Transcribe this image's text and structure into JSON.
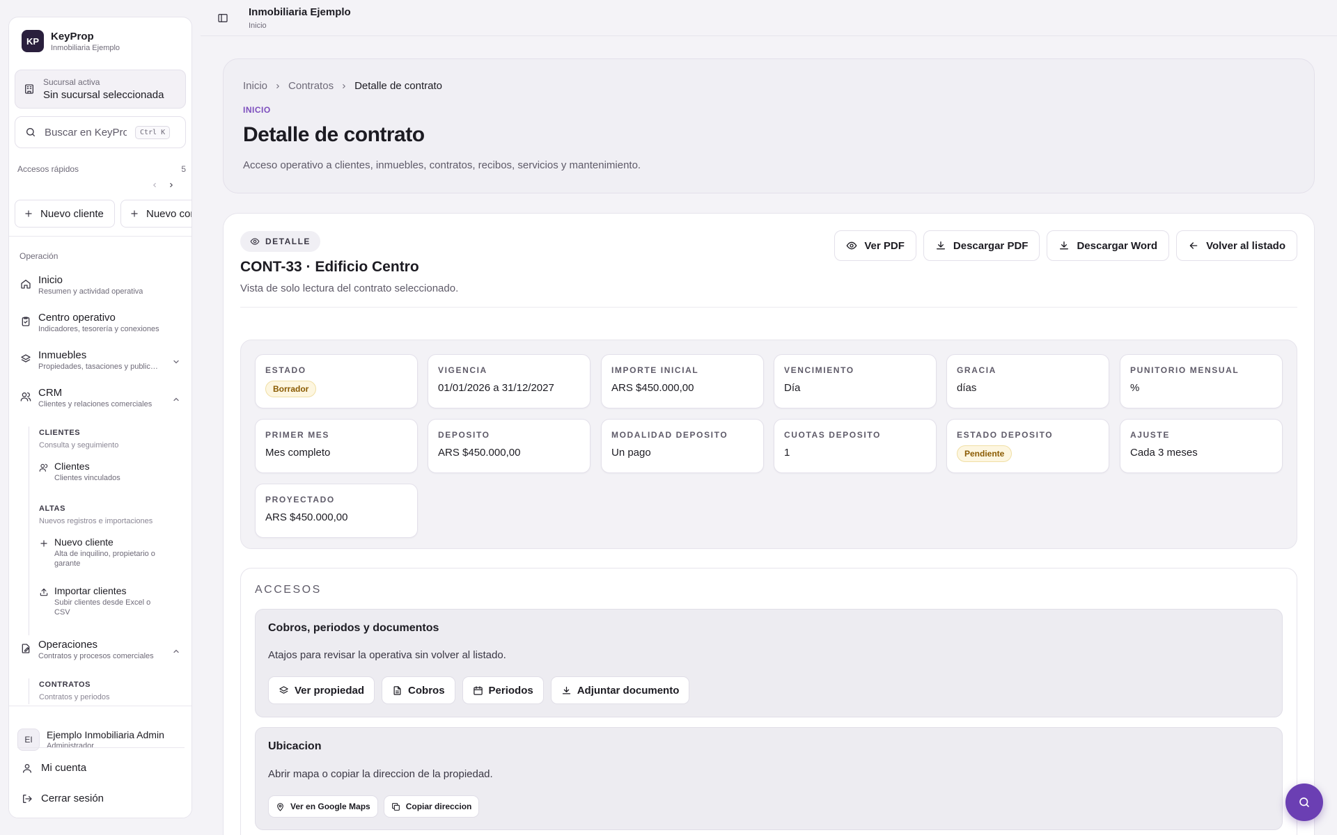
{
  "brand": {
    "initials": "KP",
    "name": "KeyProp",
    "company": "Inmobiliaria Ejemplo"
  },
  "branch": {
    "label": "Sucursal activa",
    "value": "Sin sucursal seleccionada",
    "icon": "building-icon"
  },
  "search": {
    "placeholder": "Buscar en KeyProp",
    "shortcut": "Ctrl K"
  },
  "quick_access": {
    "label": "Accesos rápidos",
    "count": "5",
    "items": [
      "Nuevo cliente",
      "Nuevo contrato"
    ]
  },
  "nav": {
    "section": "Operación",
    "inicio": {
      "title": "Inicio",
      "sub": "Resumen y actividad operativa"
    },
    "centro": {
      "title": "Centro operativo",
      "sub": "Indicadores, tesorería y conexiones"
    },
    "inmuebles": {
      "title": "Inmuebles",
      "sub": "Propiedades, tasaciones y publicaciones"
    },
    "crm": {
      "title": "CRM",
      "sub": "Clientes y relaciones comerciales"
    },
    "crm_clientes": {
      "head": "CLIENTES",
      "desc": "Consulta y seguimiento",
      "item": "Clientes",
      "item_sub": "Clientes vinculados"
    },
    "crm_altas": {
      "head": "ALTAS",
      "desc": "Nuevos registros e importaciones",
      "nuevo": "Nuevo cliente",
      "nuevo_sub": "Alta de inquilino, propietario o garante",
      "importar": "Importar clientes",
      "importar_sub": "Subir clientes desde Excel o CSV"
    },
    "operaciones": {
      "title": "Operaciones",
      "sub": "Contratos y procesos comerciales"
    },
    "op_contratos": {
      "head": "CONTRATOS",
      "desc": "Contratos y periodos"
    }
  },
  "user": {
    "initials": "EI",
    "name": "Ejemplo Inmobiliaria Admin",
    "role": "Administrador"
  },
  "footer": {
    "account": "Mi cuenta",
    "logout": "Cerrar sesión"
  },
  "topbar": {
    "title": "Inmobiliaria Ejemplo",
    "sub": "Inicio"
  },
  "header": {
    "breadcrumb": [
      "Inicio",
      "Contratos",
      "Detalle de contrato"
    ],
    "eyebrow": "INICIO",
    "title": "Detalle de contrato",
    "description": "Acceso operativo a clientes, inmuebles, contratos, recibos, servicios y mantenimiento."
  },
  "detail": {
    "pill": "DETALLE",
    "title": "CONT-33 · Edificio Centro",
    "description": "Vista de solo lectura del contrato seleccionado.",
    "actions": [
      "Ver PDF",
      "Descargar PDF",
      "Descargar Word",
      "Volver al listado"
    ]
  },
  "fields": [
    {
      "label": "ESTADO",
      "value": "Borrador",
      "badge": true
    },
    {
      "label": "VIGENCIA",
      "value": "01/01/2026 a 31/12/2027"
    },
    {
      "label": "IMPORTE INICIAL",
      "value": "ARS $450.000,00"
    },
    {
      "label": "VENCIMIENTO",
      "value": "Día"
    },
    {
      "label": "GRACIA",
      "value": "días"
    },
    {
      "label": "PUNITORIO MENSUAL",
      "value": "%"
    },
    {
      "label": "PRIMER MES",
      "value": "Mes completo"
    },
    {
      "label": "DEPOSITO",
      "value": "ARS $450.000,00"
    },
    {
      "label": "MODALIDAD DEPOSITO",
      "value": "Un pago"
    },
    {
      "label": "CUOTAS DEPOSITO",
      "value": "1"
    },
    {
      "label": "ESTADO DEPOSITO",
      "value": "Pendiente",
      "badge": true
    },
    {
      "label": "AJUSTE",
      "value": "Cada 3 meses"
    },
    {
      "label": "PROYECTADO",
      "value": "ARS $450.000,00"
    }
  ],
  "access": {
    "title": "ACCESOS",
    "panel1": {
      "title": "Cobros, periodos y documentos",
      "desc": "Atajos para revisar la operativa sin volver al listado.",
      "buttons": [
        "Ver propiedad",
        "Cobros",
        "Periodos",
        "Adjuntar documento"
      ]
    },
    "panel2": {
      "title": "Ubicacion",
      "desc": "Abrir mapa o copiar la direccion de la propiedad.",
      "buttons": [
        "Ver en Google Maps",
        "Copiar direccion"
      ]
    }
  },
  "colors": {
    "accent": "#7c4dbd",
    "fab": "#6b3fb3",
    "badge_text": "#8a5a00",
    "badge_bg": "#fdf6e0"
  }
}
